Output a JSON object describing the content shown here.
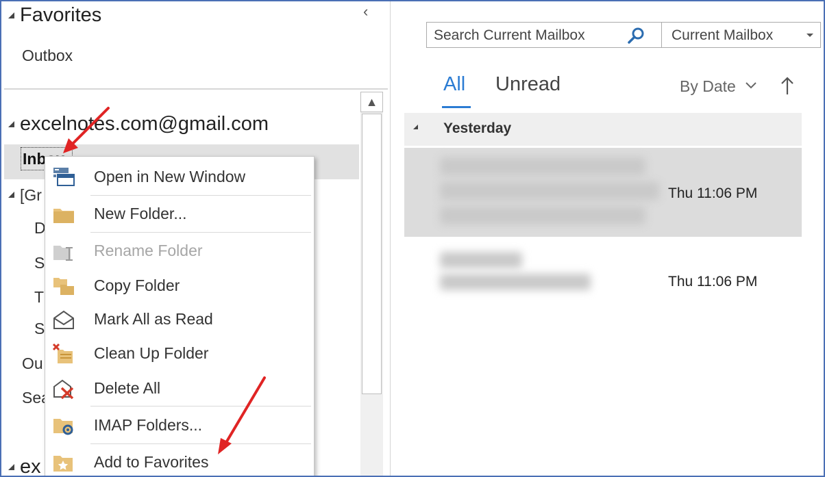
{
  "folder_pane": {
    "favorites_label": "Favorites",
    "favorite_items": [
      "Outbox"
    ],
    "account_label": "excelnotes.com@gmail.com",
    "inbox_label": "Inbox",
    "truncated_rows": [
      "[Gr",
      "D",
      "S",
      "T",
      "S",
      "Ou",
      "Sea"
    ],
    "second_account_label": "ex"
  },
  "context_menu": {
    "items": [
      {
        "label": "Open in New Window",
        "icon": "new-window-icon",
        "enabled": true
      },
      {
        "label": "New Folder...",
        "icon": "folder-icon",
        "enabled": true
      },
      {
        "label": "Rename Folder",
        "icon": "rename-folder-icon",
        "enabled": false
      },
      {
        "label": "Copy Folder",
        "icon": "copy-folder-icon",
        "enabled": true
      },
      {
        "label": "Mark All as Read",
        "icon": "open-envelope-icon",
        "enabled": true
      },
      {
        "label": "Clean Up Folder",
        "icon": "clean-up-folder-icon",
        "enabled": true
      },
      {
        "label": "Delete All",
        "icon": "delete-all-icon",
        "enabled": true
      },
      {
        "label": "IMAP Folders...",
        "icon": "imap-folders-icon",
        "enabled": true
      },
      {
        "label": "Add to Favorites",
        "icon": "add-favorite-icon",
        "enabled": true
      }
    ]
  },
  "mail_list": {
    "search_placeholder": "Search Current Mailbox",
    "scope_label": "Current Mailbox",
    "tabs": {
      "all": "All",
      "unread": "Unread"
    },
    "sort_label": "By Date",
    "group_label": "Yesterday",
    "messages": [
      {
        "time": "Thu 11:06 PM",
        "selected": true
      },
      {
        "time": "Thu 11:06 PM",
        "selected": false
      }
    ]
  },
  "colors": {
    "accent": "#2b7cd3",
    "annotation_arrow": "#e02424",
    "selection": "#dcdcdc",
    "frame_border": "#4a6fb5"
  }
}
